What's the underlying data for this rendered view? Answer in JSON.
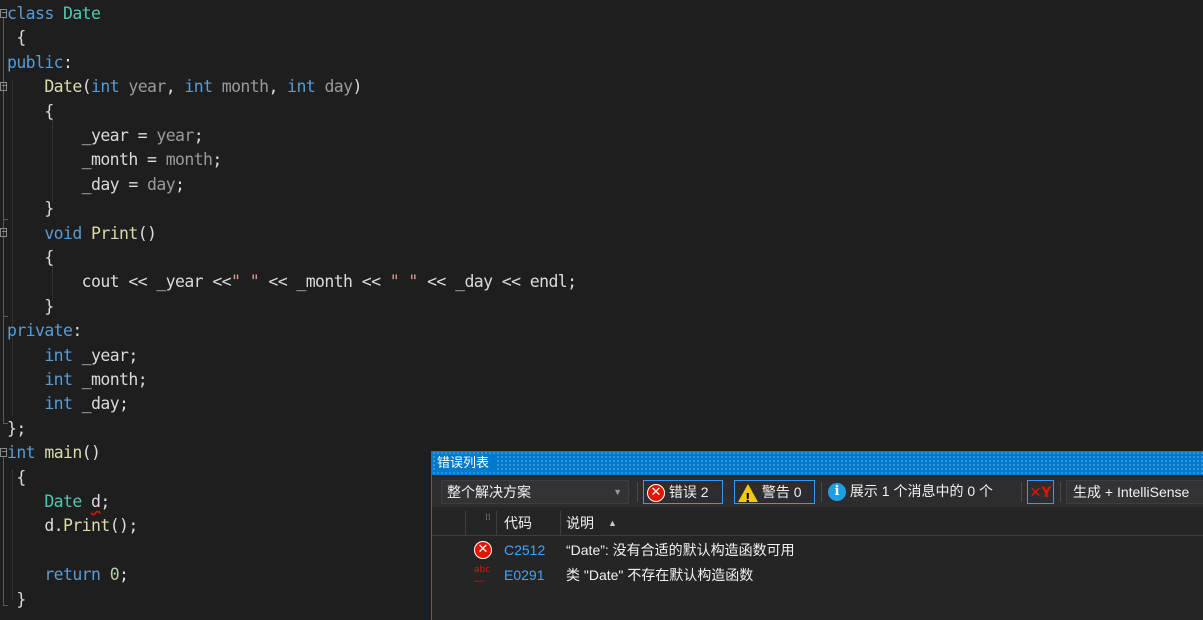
{
  "editor": {
    "lines": [
      [
        [
          "kw",
          "class"
        ],
        [
          "plain",
          " "
        ],
        [
          "type",
          "Date"
        ]
      ],
      [
        [
          "plain",
          " {"
        ]
      ],
      [
        [
          "kw",
          "public"
        ],
        [
          "plain",
          ":"
        ]
      ],
      [
        [
          "plain",
          "    "
        ],
        [
          "fn",
          "Date"
        ],
        [
          "plain",
          "("
        ],
        [
          "kw",
          "int"
        ],
        [
          "plain",
          " "
        ],
        [
          "param",
          "year"
        ],
        [
          "plain",
          ", "
        ],
        [
          "kw",
          "int"
        ],
        [
          "plain",
          " "
        ],
        [
          "param",
          "month"
        ],
        [
          "plain",
          ", "
        ],
        [
          "kw",
          "int"
        ],
        [
          "plain",
          " "
        ],
        [
          "param",
          "day"
        ],
        [
          "plain",
          ")"
        ]
      ],
      [
        [
          "plain",
          "    {"
        ]
      ],
      [
        [
          "plain",
          "        "
        ],
        [
          "field",
          "_year"
        ],
        [
          "plain",
          " = "
        ],
        [
          "param",
          "year"
        ],
        [
          "plain",
          ";"
        ]
      ],
      [
        [
          "plain",
          "        "
        ],
        [
          "field",
          "_month"
        ],
        [
          "plain",
          " = "
        ],
        [
          "param",
          "month"
        ],
        [
          "plain",
          ";"
        ]
      ],
      [
        [
          "plain",
          "        "
        ],
        [
          "field",
          "_day"
        ],
        [
          "plain",
          " = "
        ],
        [
          "param",
          "day"
        ],
        [
          "plain",
          ";"
        ]
      ],
      [
        [
          "plain",
          "    }"
        ]
      ],
      [
        [
          "plain",
          "    "
        ],
        [
          "kw",
          "void"
        ],
        [
          "plain",
          " "
        ],
        [
          "fn",
          "Print"
        ],
        [
          "plain",
          "()"
        ]
      ],
      [
        [
          "plain",
          "    {"
        ]
      ],
      [
        [
          "plain",
          "        "
        ],
        [
          "plain",
          "cout << "
        ],
        [
          "field",
          "_year"
        ],
        [
          "plain",
          " <<"
        ],
        [
          "str",
          "\" \""
        ],
        [
          "plain",
          " << "
        ],
        [
          "field",
          "_month"
        ],
        [
          "plain",
          " << "
        ],
        [
          "str",
          "\" \""
        ],
        [
          "plain",
          " << "
        ],
        [
          "field",
          "_day"
        ],
        [
          "plain",
          " << endl;"
        ]
      ],
      [
        [
          "plain",
          "    }"
        ]
      ],
      [
        [
          "kw",
          "private"
        ],
        [
          "plain",
          ":"
        ]
      ],
      [
        [
          "plain",
          "    "
        ],
        [
          "kw",
          "int"
        ],
        [
          "plain",
          " "
        ],
        [
          "field",
          "_year"
        ],
        [
          "plain",
          ";"
        ]
      ],
      [
        [
          "plain",
          "    "
        ],
        [
          "kw",
          "int"
        ],
        [
          "plain",
          " "
        ],
        [
          "field",
          "_month"
        ],
        [
          "plain",
          ";"
        ]
      ],
      [
        [
          "plain",
          "    "
        ],
        [
          "kw",
          "int"
        ],
        [
          "plain",
          " "
        ],
        [
          "field",
          "_day"
        ],
        [
          "plain",
          ";"
        ]
      ],
      [
        [
          "plain",
          "};"
        ]
      ],
      [
        [
          "kw",
          "int"
        ],
        [
          "plain",
          " "
        ],
        [
          "fn",
          "main"
        ],
        [
          "plain",
          "()"
        ]
      ],
      [
        [
          "plain",
          " {"
        ]
      ],
      [
        [
          "plain",
          "    "
        ],
        [
          "type",
          "Date"
        ],
        [
          "plain",
          " "
        ],
        [
          "err",
          "d"
        ],
        [
          "plain",
          ";"
        ]
      ],
      [
        [
          "plain",
          "    "
        ],
        [
          "plain",
          "d."
        ],
        [
          "fn",
          "Print"
        ],
        [
          "plain",
          "();"
        ]
      ],
      [
        [
          "plain",
          ""
        ]
      ],
      [
        [
          "plain",
          "    "
        ],
        [
          "kw",
          "return"
        ],
        [
          "plain",
          " "
        ],
        [
          "num",
          "0"
        ],
        [
          "plain",
          ";"
        ]
      ],
      [
        [
          "plain",
          " }"
        ]
      ]
    ]
  },
  "errorList": {
    "title": "错误列表",
    "scope": "整个解决方案",
    "errorsLabel": "错误 2",
    "warningsLabel": "警告 0",
    "messagesLabel": "展示 1 个消息中的 0 个",
    "buildLabel": "生成 + IntelliSense",
    "colCode": "代码",
    "colDesc": "说明",
    "rows": [
      {
        "icon": "error-icon",
        "code": "C2512",
        "desc": "“Date”: 没有合适的默认构造函数可用"
      },
      {
        "icon": "intellisense-icon",
        "code": "E0291",
        "desc": "类 \"Date\" 不存在默认构造函数"
      }
    ]
  }
}
